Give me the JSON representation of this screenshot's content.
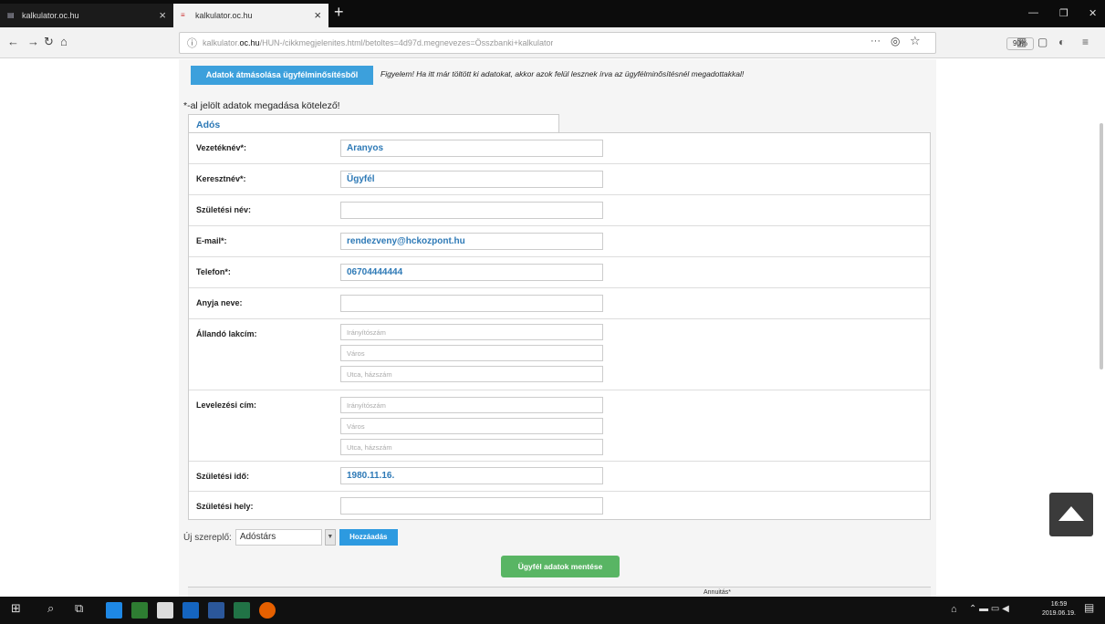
{
  "browser": {
    "tabs": [
      {
        "title": "kalkulator.oc.hu",
        "active": false
      },
      {
        "title": "kalkulator.oc.hu",
        "active": true
      }
    ],
    "url_prefix": "kalkulator.",
    "url_domain": "oc.hu",
    "url_rest": "/HUN-/cikkmegjelenites.html/betoltes=4d97d.megnevezes=Összbanki+kalkulator",
    "zoom": "90%",
    "icons": {
      "back": "back-arrow-icon",
      "forward": "forward-arrow-icon",
      "reload": "reload-icon",
      "home": "home-icon"
    }
  },
  "page": {
    "transfer_button": "Adatok átmásolása ügyfélminősítésből",
    "warning": "Figyelem! Ha itt már töltött ki adatokat, akkor azok felül lesznek írva az ügyfélminősítésnél megadottakkal!",
    "required_note": "*-al jelölt adatok megadása kötelező!",
    "tab_label": "Adós",
    "fields": {
      "vezeteknev": {
        "label": "Vezetéknév*:",
        "value": "Aranyos"
      },
      "keresztnev": {
        "label": "Keresztnév*:",
        "value": "Ügyfél"
      },
      "szuletesi_nev": {
        "label": "Születési név:",
        "value": ""
      },
      "email": {
        "label": "E-mail*:",
        "value": "rendezveny@hckozpont.hu"
      },
      "telefon": {
        "label": "Telefon*:",
        "value": "06704444444"
      },
      "anyja_neve": {
        "label": "Anyja neve:",
        "value": ""
      },
      "allando_lakcim": {
        "label": "Állandó lakcím:",
        "placeholders": [
          "Irányítószám",
          "Város",
          "Utca, házszám"
        ]
      },
      "levelezesi_cim": {
        "label": "Levelezési cím:",
        "placeholders": [
          "Irányítószám",
          "Város",
          "Utca, házszám"
        ]
      },
      "szuletesi_ido": {
        "label": "Születési idő:",
        "value": "1980.11.16."
      },
      "szuletesi_hely": {
        "label": "Születési hely:",
        "value": ""
      }
    },
    "role": {
      "label": "Új szereplő:",
      "selected": "Adóstárs",
      "add_button": "Hozzáadás"
    },
    "save_button": "Ügyfél adatok mentése",
    "table_header": "Annuitás*"
  },
  "taskbar": {
    "time": "16:59",
    "date": "2019.06.19."
  },
  "colors": {
    "accent": "#3ca0dc",
    "value_text": "#2d79b6",
    "save_green": "#59b564"
  }
}
